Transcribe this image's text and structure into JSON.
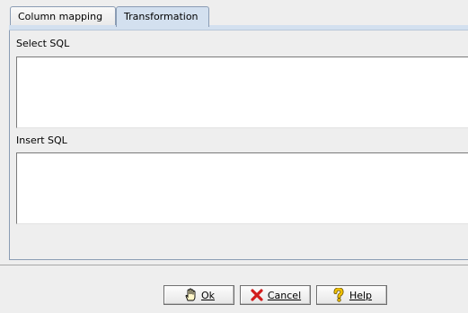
{
  "tabs": [
    {
      "label": "Column mapping",
      "active": false
    },
    {
      "label": "Transformation",
      "active": true
    }
  ],
  "transformation": {
    "select_sql_label": "Select SQL",
    "select_sql_value": "",
    "insert_sql_label": "Insert SQL",
    "insert_sql_value": ""
  },
  "buttons": {
    "ok": {
      "label": "Ok",
      "icon": "hand-icon"
    },
    "cancel": {
      "label": "Cancel",
      "icon": "red-x-icon"
    },
    "help": {
      "label": "Help",
      "icon": "question-mark-icon"
    }
  },
  "colors": {
    "active_tab": "#d3e0ef",
    "background": "#eeeeee",
    "cancel_icon": "#d21c1c",
    "help_icon": "#f2c200"
  }
}
